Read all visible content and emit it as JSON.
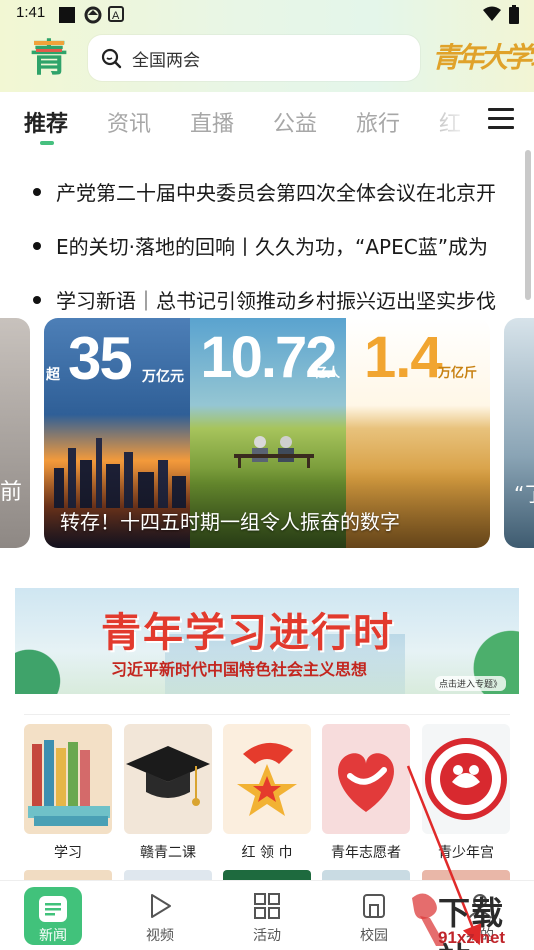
{
  "status_bar": {
    "time": "1:41"
  },
  "header": {
    "logo_text": "青",
    "search_placeholder": "全国两会",
    "brand_logo_text": "青年大学习"
  },
  "tabs": [
    {
      "label": "推荐",
      "active": true
    },
    {
      "label": "资讯",
      "active": false
    },
    {
      "label": "直播",
      "active": false
    },
    {
      "label": "公益",
      "active": false
    },
    {
      "label": "旅行",
      "active": false
    },
    {
      "label": "红",
      "active": false
    }
  ],
  "headlines": [
    "产党第二十届中央委员会第四次全体会议在北京开",
    "E的关切·落地的回响丨久久为功，“APEC蓝”成为",
    "学习新语｜总书记引领推动乡村振兴迈出坚实步伐"
  ],
  "carousel": {
    "caption": "转存！十四五时期一组令人振奋的数字",
    "prev_fragment": "前",
    "next_fragment": "“了",
    "panels": [
      {
        "prefix": "超",
        "value": "35",
        "unit": "万亿元"
      },
      {
        "prefix": "",
        "value": "10.72",
        "unit": "亿人"
      },
      {
        "prefix": "",
        "value": "1.4",
        "unit": "万亿斤"
      }
    ]
  },
  "banner": {
    "title": "青年学习进行时",
    "subtitle": "习近平新时代中国特色社会主义思想",
    "link": "点击进入专题》"
  },
  "shortcuts": [
    {
      "label": "学习",
      "icon": "books-icon"
    },
    {
      "label": "赣青二课",
      "icon": "graduation-cap-icon"
    },
    {
      "label": "红 领 巾",
      "icon": "young-pioneer-badge-icon"
    },
    {
      "label": "青年志愿者",
      "icon": "volunteer-heart-icon"
    },
    {
      "label": "青少年宫",
      "icon": "youth-palace-emblem-icon"
    }
  ],
  "bottom_nav": [
    {
      "label": "新闻",
      "icon": "news-icon",
      "active": true
    },
    {
      "label": "视频",
      "icon": "play-icon",
      "active": false
    },
    {
      "label": "活动",
      "icon": "grid-icon",
      "active": false
    },
    {
      "label": "校园",
      "icon": "campus-icon",
      "active": false
    },
    {
      "label": "我的",
      "icon": "profile-icon",
      "active": false
    }
  ],
  "watermark": {
    "text": "下载站",
    "domain": "91xz.net"
  },
  "colors": {
    "accent_green": "#41c27b",
    "banner_red": "#e23a2d",
    "annotation_arrow": "#e02a2a"
  }
}
